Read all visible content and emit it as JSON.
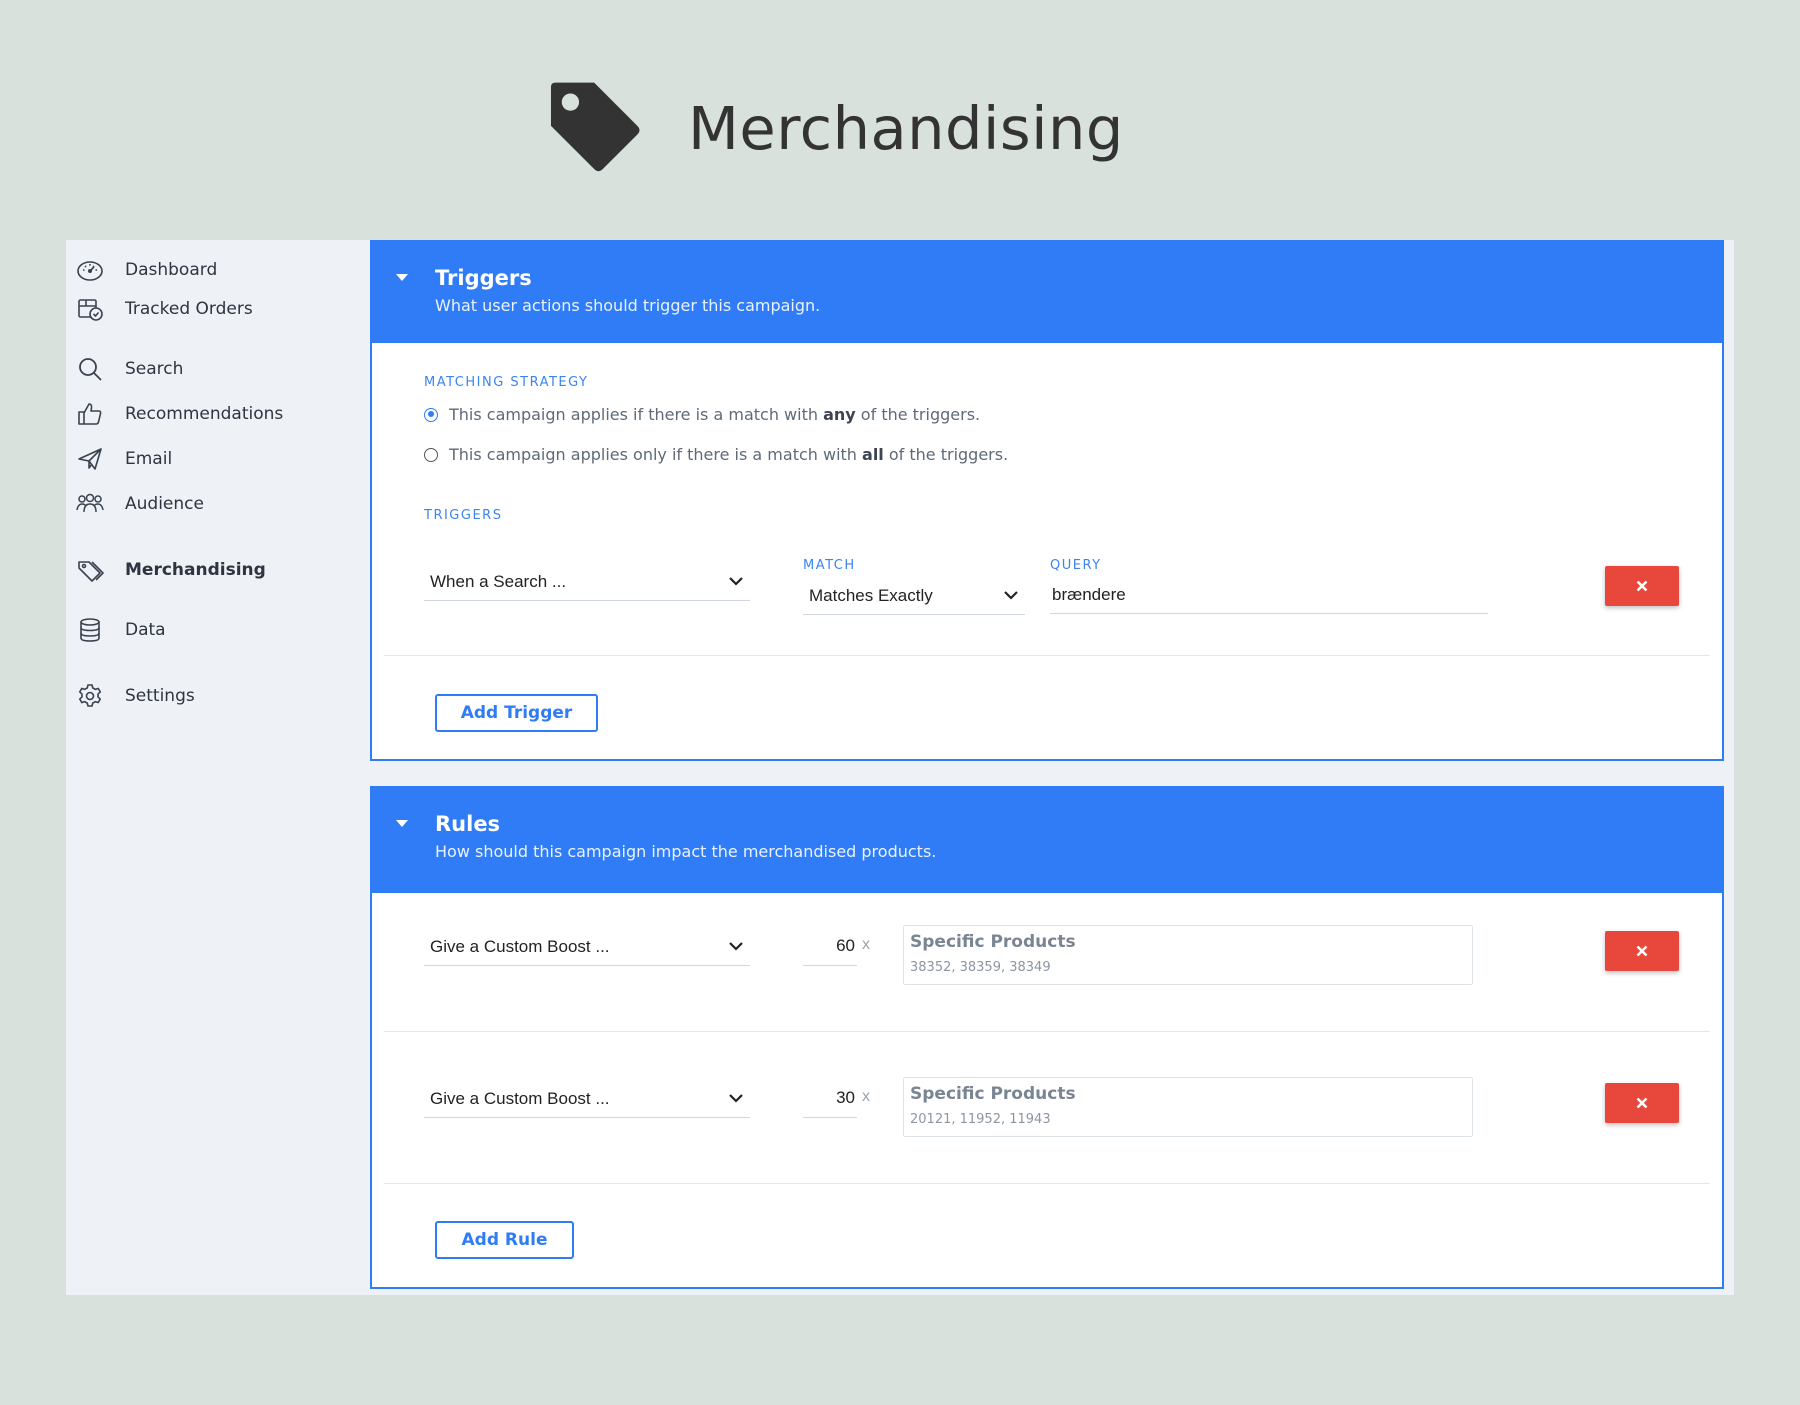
{
  "page": {
    "title": "Merchandising",
    "hero_icon": "price-tag-icon"
  },
  "colors": {
    "accent": "#2f7cf6",
    "danger": "#e8473c",
    "background": "#d9e1dd",
    "sidebar": "#eef1f5"
  },
  "sidebar": {
    "items": [
      {
        "label": "Dashboard",
        "icon": "dashboard-gauge-icon"
      },
      {
        "label": "Tracked Orders",
        "icon": "tracked-orders-icon"
      },
      {
        "label": "Search",
        "icon": "search-icon"
      },
      {
        "label": "Recommendations",
        "icon": "thumbs-up-icon"
      },
      {
        "label": "Email",
        "icon": "paper-plane-icon"
      },
      {
        "label": "Audience",
        "icon": "people-icon"
      },
      {
        "label": "Merchandising",
        "icon": "tags-icon",
        "active": true
      },
      {
        "label": "Data",
        "icon": "database-icon"
      },
      {
        "label": "Settings",
        "icon": "gear-icon"
      }
    ]
  },
  "triggers": {
    "title": "Triggers",
    "subtitle": "What user actions should trigger this campaign.",
    "matching_strategy_label": "MATCHING STRATEGY",
    "options": [
      {
        "pre": "This campaign applies if there is a match with ",
        "bold": "any",
        "post": " of the triggers.",
        "checked": true
      },
      {
        "pre": "This campaign applies only if there is a match with ",
        "bold": "all",
        "post": " of the triggers.",
        "checked": false
      }
    ],
    "triggers_label": "TRIGGERS",
    "row": {
      "type_value": "When a Search ...",
      "match_label": "MATCH",
      "match_value": "Matches Exactly",
      "query_label": "QUERY",
      "query_value": "brændere"
    },
    "add_button": "Add Trigger"
  },
  "rules": {
    "title": "Rules",
    "subtitle": "How should this campaign impact the merchandised products.",
    "multiplier_symbol": "x",
    "items": [
      {
        "type_value": "Give a Custom Boost ...",
        "boost": "60",
        "target_title": "Specific Products",
        "product_ids": "38352, 38359, 38349"
      },
      {
        "type_value": "Give a Custom Boost ...",
        "boost": "30",
        "target_title": "Specific Products",
        "product_ids": "20121, 11952, 11943"
      }
    ],
    "add_button": "Add Rule"
  }
}
